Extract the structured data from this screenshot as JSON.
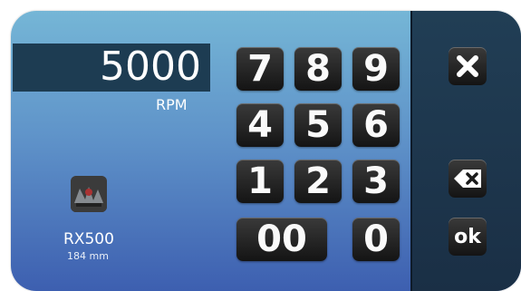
{
  "display": {
    "value": "5000",
    "unit": "RPM"
  },
  "keypad": {
    "keys": [
      "7",
      "8",
      "9",
      "4",
      "5",
      "6",
      "1",
      "2",
      "3",
      "00",
      "0"
    ]
  },
  "actions": {
    "ok_label": "ok"
  },
  "tool": {
    "name": "RX500",
    "size": "184 mm"
  },
  "colors": {
    "background_top": "#75b6d6",
    "background_bottom": "#3d5fb0",
    "side_panel": "#1a2f45",
    "display_bg": "#1d3c52",
    "key_bg": "#1f1f1f",
    "text": "#ffffff"
  }
}
